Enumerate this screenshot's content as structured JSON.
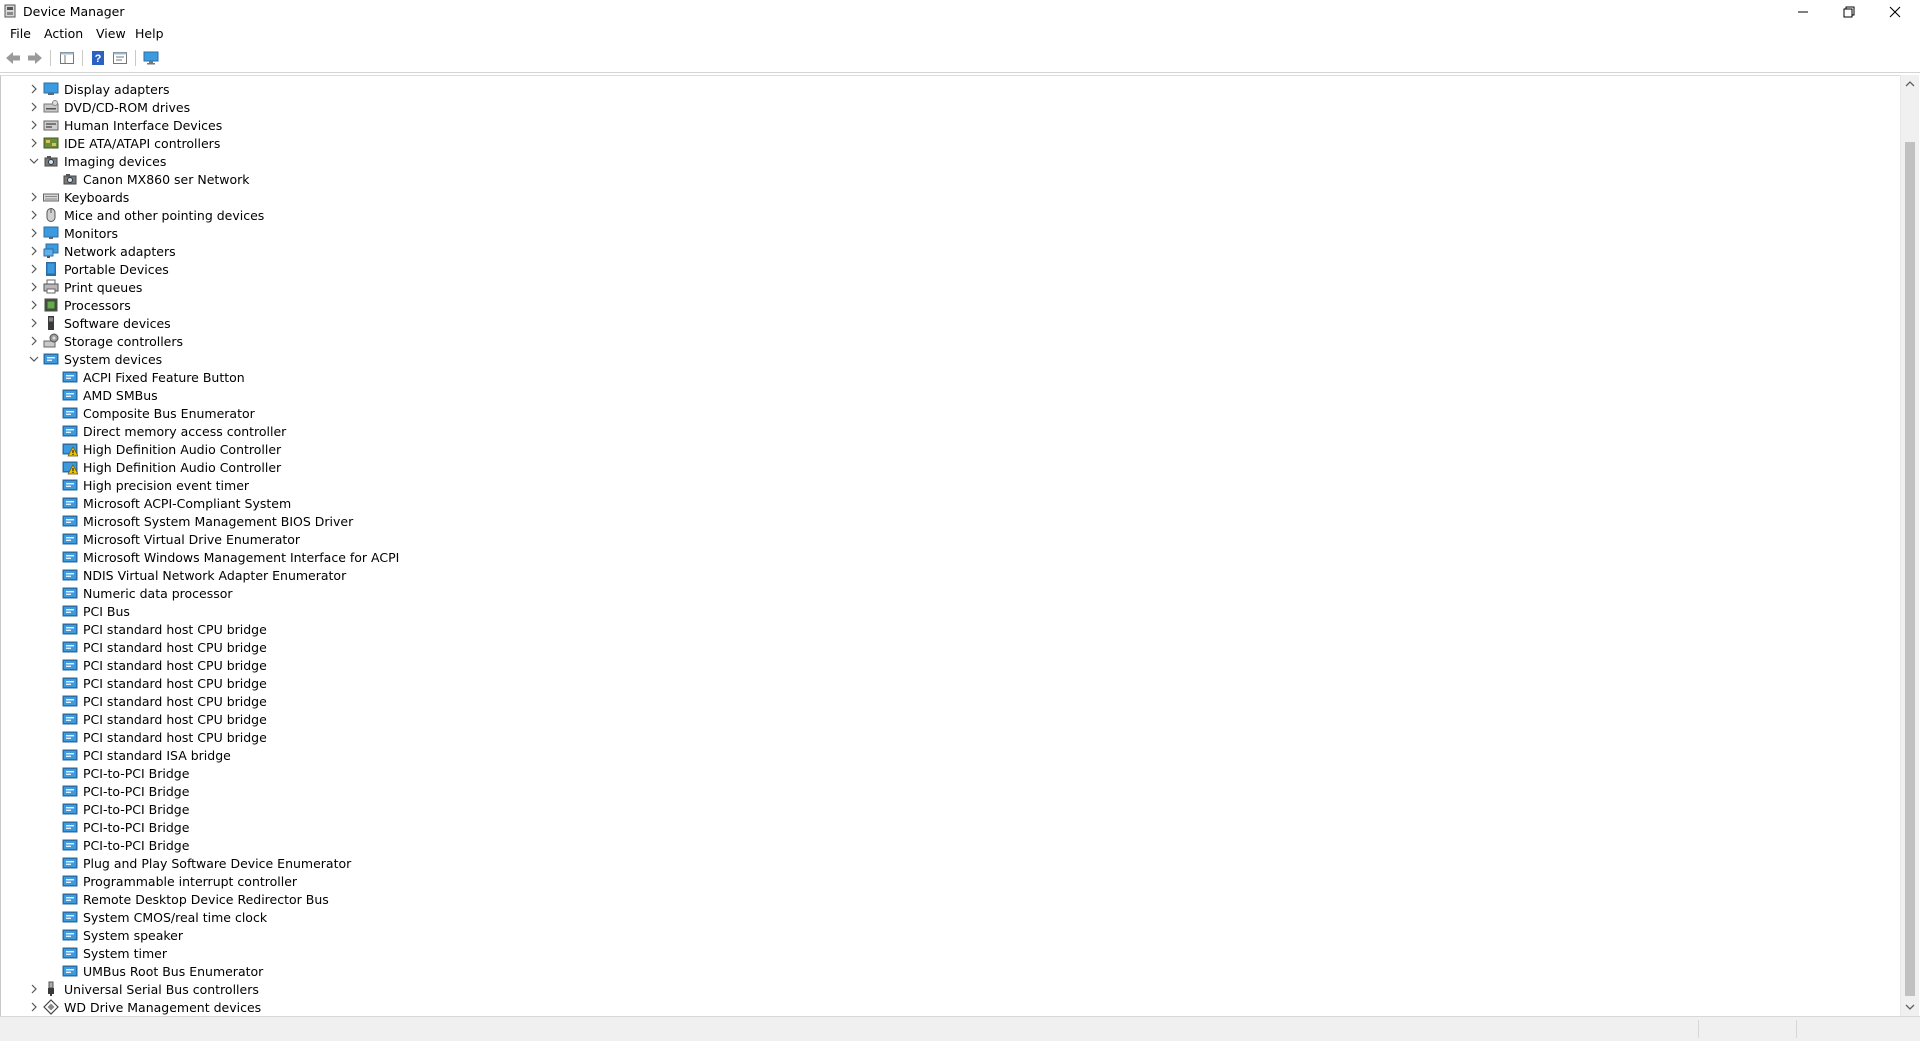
{
  "window": {
    "title": "Device Manager"
  },
  "menu": [
    "File",
    "Action",
    "View",
    "Help"
  ],
  "toolbar": {
    "buttons": [
      "back-icon",
      "forward-icon",
      "show-hide-console-tree-icon",
      "help-icon",
      "properties-icon",
      "scan-hardware-icon"
    ]
  },
  "tree": {
    "items": [
      {
        "label": "Display adapters",
        "level": 1,
        "expander": "collapsed",
        "icon": "display-adapter-icon"
      },
      {
        "label": "DVD/CD-ROM drives",
        "level": 1,
        "expander": "collapsed",
        "icon": "dvd-drive-icon"
      },
      {
        "label": "Human Interface Devices",
        "level": 1,
        "expander": "collapsed",
        "icon": "hid-icon"
      },
      {
        "label": "IDE ATA/ATAPI controllers",
        "level": 1,
        "expander": "collapsed",
        "icon": "ide-controller-icon"
      },
      {
        "label": "Imaging devices",
        "level": 1,
        "expander": "expanded",
        "icon": "imaging-device-icon"
      },
      {
        "label": "Canon MX860 ser Network",
        "level": 2,
        "expander": "none",
        "icon": "imaging-device-icon"
      },
      {
        "label": "Keyboards",
        "level": 1,
        "expander": "collapsed",
        "icon": "keyboard-icon"
      },
      {
        "label": "Mice and other pointing devices",
        "level": 1,
        "expander": "collapsed",
        "icon": "mouse-icon"
      },
      {
        "label": "Monitors",
        "level": 1,
        "expander": "collapsed",
        "icon": "monitor-icon"
      },
      {
        "label": "Network adapters",
        "level": 1,
        "expander": "collapsed",
        "icon": "network-adapter-icon"
      },
      {
        "label": "Portable Devices",
        "level": 1,
        "expander": "collapsed",
        "icon": "portable-device-icon"
      },
      {
        "label": "Print queues",
        "level": 1,
        "expander": "collapsed",
        "icon": "printer-icon"
      },
      {
        "label": "Processors",
        "level": 1,
        "expander": "collapsed",
        "icon": "processor-icon"
      },
      {
        "label": "Software devices",
        "level": 1,
        "expander": "collapsed",
        "icon": "software-device-icon"
      },
      {
        "label": "Storage controllers",
        "level": 1,
        "expander": "collapsed",
        "icon": "storage-controller-icon"
      },
      {
        "label": "System devices",
        "level": 1,
        "expander": "expanded",
        "icon": "system-device-icon"
      },
      {
        "label": "ACPI Fixed Feature Button",
        "level": 2,
        "expander": "none",
        "icon": "system-device-icon"
      },
      {
        "label": "AMD SMBus",
        "level": 2,
        "expander": "none",
        "icon": "system-device-icon"
      },
      {
        "label": "Composite Bus Enumerator",
        "level": 2,
        "expander": "none",
        "icon": "system-device-icon"
      },
      {
        "label": "Direct memory access controller",
        "level": 2,
        "expander": "none",
        "icon": "system-device-icon"
      },
      {
        "label": "High Definition Audio Controller",
        "level": 2,
        "expander": "none",
        "icon": "system-device-warning-icon"
      },
      {
        "label": "High Definition Audio Controller",
        "level": 2,
        "expander": "none",
        "icon": "system-device-warning-icon"
      },
      {
        "label": "High precision event timer",
        "level": 2,
        "expander": "none",
        "icon": "system-device-icon"
      },
      {
        "label": "Microsoft ACPI-Compliant System",
        "level": 2,
        "expander": "none",
        "icon": "system-device-icon"
      },
      {
        "label": "Microsoft System Management BIOS Driver",
        "level": 2,
        "expander": "none",
        "icon": "system-device-icon"
      },
      {
        "label": "Microsoft Virtual Drive Enumerator",
        "level": 2,
        "expander": "none",
        "icon": "system-device-icon"
      },
      {
        "label": "Microsoft Windows Management Interface for ACPI",
        "level": 2,
        "expander": "none",
        "icon": "system-device-icon"
      },
      {
        "label": "NDIS Virtual Network Adapter Enumerator",
        "level": 2,
        "expander": "none",
        "icon": "system-device-icon"
      },
      {
        "label": "Numeric data processor",
        "level": 2,
        "expander": "none",
        "icon": "system-device-icon"
      },
      {
        "label": "PCI Bus",
        "level": 2,
        "expander": "none",
        "icon": "system-device-icon"
      },
      {
        "label": "PCI standard host CPU bridge",
        "level": 2,
        "expander": "none",
        "icon": "system-device-icon"
      },
      {
        "label": "PCI standard host CPU bridge",
        "level": 2,
        "expander": "none",
        "icon": "system-device-icon"
      },
      {
        "label": "PCI standard host CPU bridge",
        "level": 2,
        "expander": "none",
        "icon": "system-device-icon"
      },
      {
        "label": "PCI standard host CPU bridge",
        "level": 2,
        "expander": "none",
        "icon": "system-device-icon"
      },
      {
        "label": "PCI standard host CPU bridge",
        "level": 2,
        "expander": "none",
        "icon": "system-device-icon"
      },
      {
        "label": "PCI standard host CPU bridge",
        "level": 2,
        "expander": "none",
        "icon": "system-device-icon"
      },
      {
        "label": "PCI standard host CPU bridge",
        "level": 2,
        "expander": "none",
        "icon": "system-device-icon"
      },
      {
        "label": "PCI standard ISA bridge",
        "level": 2,
        "expander": "none",
        "icon": "system-device-icon"
      },
      {
        "label": "PCI-to-PCI Bridge",
        "level": 2,
        "expander": "none",
        "icon": "system-device-icon"
      },
      {
        "label": "PCI-to-PCI Bridge",
        "level": 2,
        "expander": "none",
        "icon": "system-device-icon"
      },
      {
        "label": "PCI-to-PCI Bridge",
        "level": 2,
        "expander": "none",
        "icon": "system-device-icon"
      },
      {
        "label": "PCI-to-PCI Bridge",
        "level": 2,
        "expander": "none",
        "icon": "system-device-icon"
      },
      {
        "label": "PCI-to-PCI Bridge",
        "level": 2,
        "expander": "none",
        "icon": "system-device-icon"
      },
      {
        "label": "Plug and Play Software Device Enumerator",
        "level": 2,
        "expander": "none",
        "icon": "system-device-icon"
      },
      {
        "label": "Programmable interrupt controller",
        "level": 2,
        "expander": "none",
        "icon": "system-device-icon"
      },
      {
        "label": "Remote Desktop Device Redirector Bus",
        "level": 2,
        "expander": "none",
        "icon": "system-device-icon"
      },
      {
        "label": "System CMOS/real time clock",
        "level": 2,
        "expander": "none",
        "icon": "system-device-icon"
      },
      {
        "label": "System speaker",
        "level": 2,
        "expander": "none",
        "icon": "system-device-icon"
      },
      {
        "label": "System timer",
        "level": 2,
        "expander": "none",
        "icon": "system-device-icon"
      },
      {
        "label": "UMBus Root Bus Enumerator",
        "level": 2,
        "expander": "none",
        "icon": "system-device-icon"
      },
      {
        "label": "Universal Serial Bus controllers",
        "level": 1,
        "expander": "collapsed",
        "icon": "usb-controller-icon"
      },
      {
        "label": "WD Drive Management devices",
        "level": 1,
        "expander": "collapsed",
        "icon": "wd-drive-icon"
      }
    ]
  },
  "colors": {
    "folder_blue": "#3c9ade",
    "warning_yellow": "#f5c400",
    "text": "#000000"
  }
}
